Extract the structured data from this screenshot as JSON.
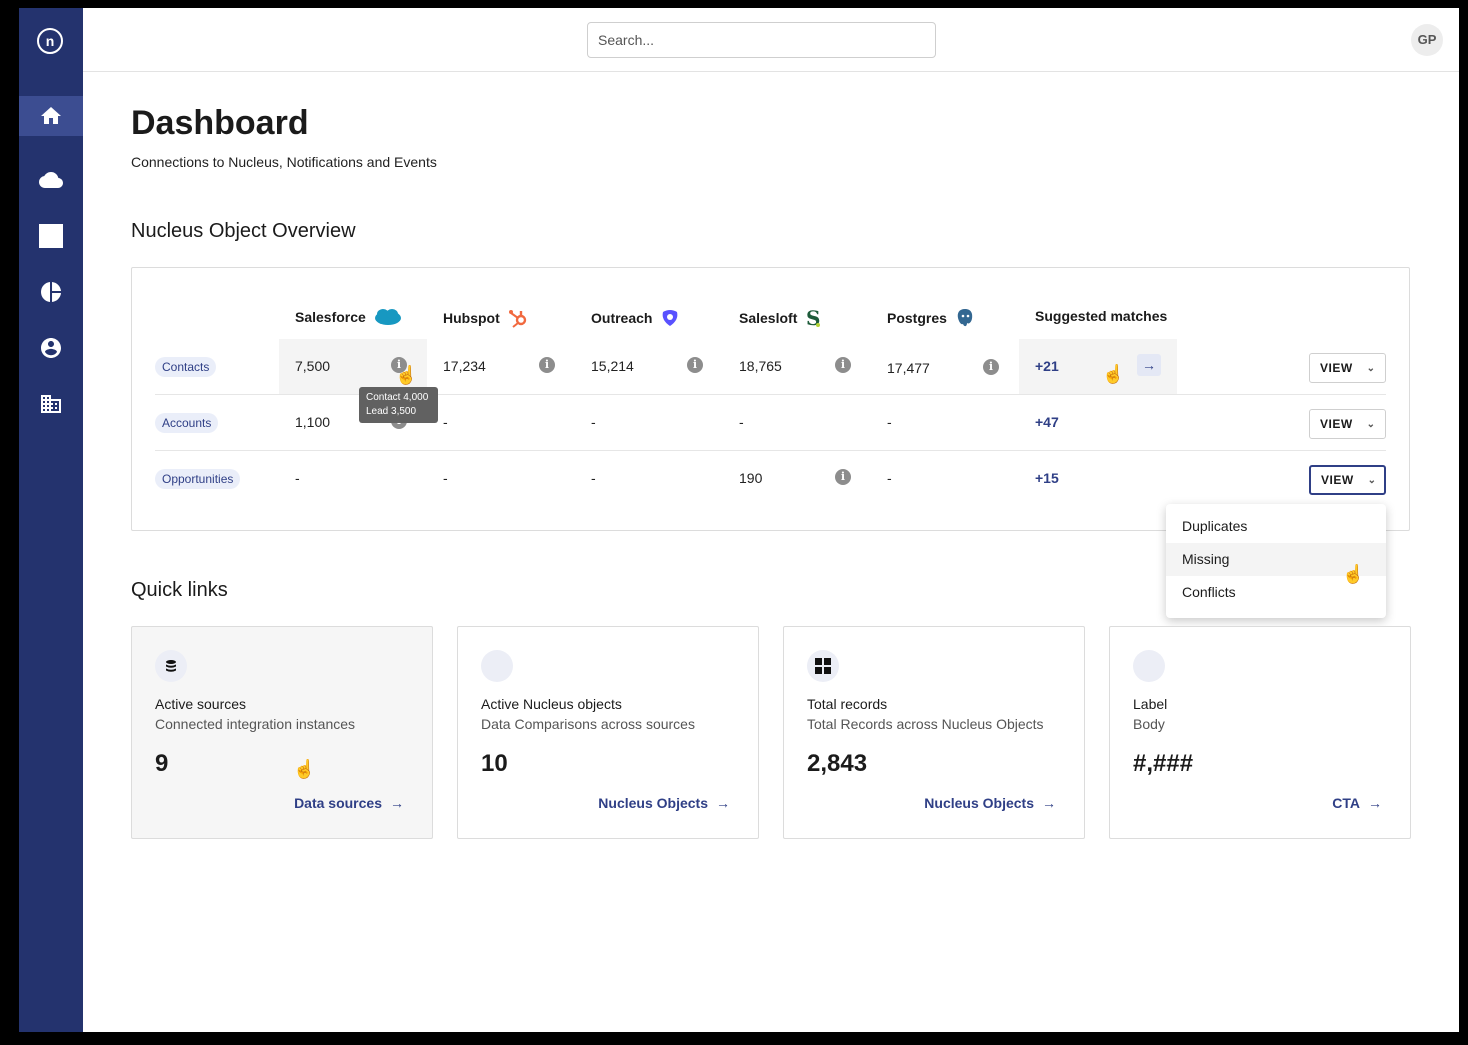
{
  "app": {
    "logo": "n",
    "avatar_initials": "GP"
  },
  "search": {
    "placeholder": "Search..."
  },
  "sidebar": {
    "items": [
      "home-icon",
      "cloud-icon",
      "square-icon",
      "pie-chart-icon",
      "account-icon",
      "building-icon"
    ]
  },
  "page": {
    "title": "Dashboard",
    "subtitle": "Connections to Nucleus, Notifications and Events"
  },
  "overview": {
    "title": "Nucleus Object Overview",
    "columns": [
      "Salesforce",
      "Hubspot",
      "Outreach",
      "Salesloft",
      "Postgres",
      "Suggested matches"
    ],
    "rows": [
      {
        "label": "Contacts",
        "values": [
          "7,500",
          "17,234",
          "15,214",
          "18,765",
          "17,477"
        ],
        "suggested": "+21",
        "button": "VIEW"
      },
      {
        "label": "Accounts",
        "values": [
          "1,100",
          "-",
          "-",
          "-",
          "-"
        ],
        "suggested": "+47",
        "button": "VIEW"
      },
      {
        "label": "Opportunities",
        "values": [
          "-",
          "-",
          "-",
          "190",
          "-"
        ],
        "suggested": "+15",
        "button": "VIEW"
      }
    ],
    "tooltip": {
      "line1": "Contact 4,000",
      "line2": "Lead 3,500"
    },
    "menu": [
      "Duplicates",
      "Missing",
      "Conflicts"
    ]
  },
  "quick_links": {
    "title": "Quick links",
    "cards": [
      {
        "label": "Active sources",
        "body": "Connected integration instances",
        "value": "9",
        "link": "Data sources",
        "icon": "database-icon"
      },
      {
        "label": "Active Nucleus objects",
        "body": "Data Comparisons across sources",
        "value": "10",
        "link": "Nucleus Objects",
        "icon": "placeholder-icon"
      },
      {
        "label": "Total records",
        "body": "Total Records across Nucleus Objects",
        "value": "2,843",
        "link": "Nucleus Objects",
        "icon": "grid-icon"
      },
      {
        "label": "Label",
        "body": "Body",
        "value": "#,###",
        "link": "CTA",
        "icon": "placeholder-icon"
      }
    ]
  },
  "colors": {
    "sidebar": "#24336e",
    "accent": "#2f3f86"
  }
}
